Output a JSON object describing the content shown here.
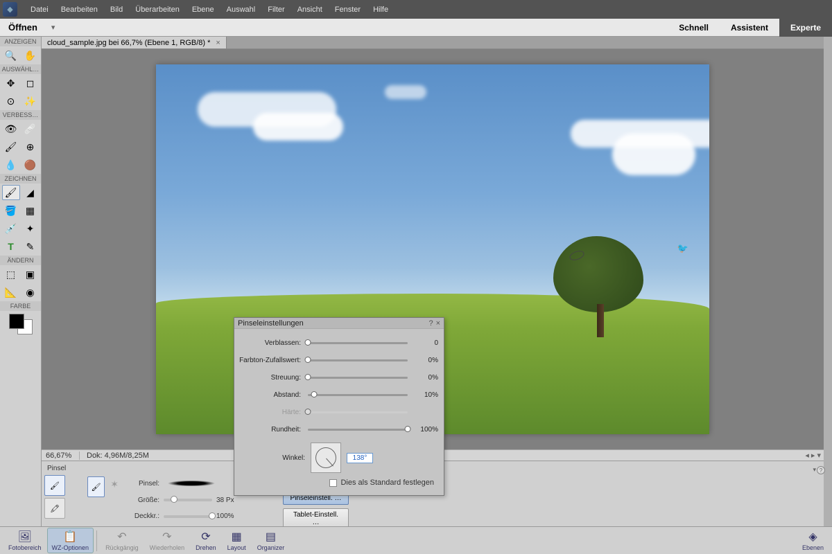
{
  "menu": {
    "items": [
      "Datei",
      "Bearbeiten",
      "Bild",
      "Überarbeiten",
      "Ebene",
      "Auswahl",
      "Filter",
      "Ansicht",
      "Fenster",
      "Hilfe"
    ]
  },
  "modebar": {
    "open": "Öffnen",
    "tabs": [
      "Schnell",
      "Assistent",
      "Experte"
    ],
    "active": 2
  },
  "doc": {
    "tab": "cloud_sample.jpg bei 66,7% (Ebene 1, RGB/8) *"
  },
  "toolbar": {
    "sections": [
      "ANZEIGEN",
      "AUSWÄHL…",
      "VERBESS…",
      "ZEICHNEN",
      "ÄNDERN",
      "FARBE"
    ]
  },
  "status": {
    "zoom": "66,67%",
    "docinfo": "Dok: 4,96M/8,25M"
  },
  "options": {
    "title": "Pinsel",
    "brush_lbl": "Pinsel:",
    "size_lbl": "Größe:",
    "size_val": "38 Px",
    "opacity_lbl": "Deckkr.:",
    "opacity_val": "100%",
    "btn1": "Pinseleinstell. …",
    "btn2": "Tablet-Einstell. …"
  },
  "dialog": {
    "title": "Pinseleinstellungen",
    "rows": [
      {
        "label": "Verblassen:",
        "value": "0",
        "pos": 0
      },
      {
        "label": "Farbton-Zufallswert:",
        "value": "0%",
        "pos": 0
      },
      {
        "label": "Streuung:",
        "value": "0%",
        "pos": 0
      },
      {
        "label": "Abstand:",
        "value": "10%",
        "pos": 10
      },
      {
        "label": "Härte:",
        "value": "",
        "pos": 0,
        "disabled": true
      },
      {
        "label": "Rundheit:",
        "value": "100%",
        "pos": 100
      }
    ],
    "angle_lbl": "Winkel:",
    "angle_val": "138°",
    "default_lbl": "Dies als Standard festlegen"
  },
  "footer": {
    "items": [
      {
        "label": "Fotobereich",
        "icon": "🖼"
      },
      {
        "label": "WZ-Optionen",
        "icon": "📋",
        "sel": true
      },
      {
        "label": "Rückgängig",
        "icon": "↶",
        "gray": true
      },
      {
        "label": "Wiederholen",
        "icon": "↷",
        "gray": true
      },
      {
        "label": "Drehen",
        "icon": "⟳"
      },
      {
        "label": "Layout",
        "icon": "▦"
      },
      {
        "label": "Organizer",
        "icon": "▤"
      }
    ],
    "right": {
      "label": "Ebenen",
      "icon": "◈"
    }
  }
}
